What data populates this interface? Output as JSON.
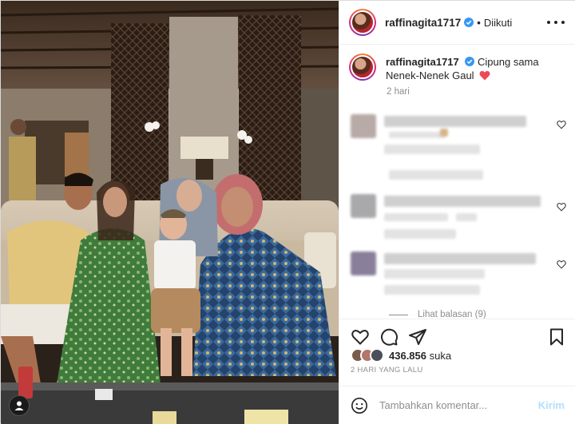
{
  "post": {
    "username": "raffinagita1717",
    "follow_status": "Diikuti",
    "separator": "•",
    "caption": {
      "username": "raffinagita1717",
      "text": "Cipung sama Nenek-Nenek Gaul"
    },
    "caption_time": "2 hari",
    "view_replies": "Lihat balasan (9)",
    "likes_count": "436.856",
    "likes_suffix": "suka",
    "posted_ago": "2 HARI YANG LALU",
    "comment_placeholder": "Tambahkan komentar...",
    "post_label": "Kirim"
  },
  "icons": {
    "verified": "verified-badge-icon",
    "more": "more-options-icon",
    "like": "heart-icon",
    "comment": "comment-bubble-icon",
    "share": "paper-plane-icon",
    "save": "bookmark-icon",
    "emoji": "emoji-icon",
    "photo_user": "user-tag-icon"
  },
  "colors": {
    "verified_blue": "#3897f0",
    "heart_red": "#ed4956",
    "secondary_text": "#8e8e8e",
    "post_button_disabled": "#b2dffc"
  }
}
